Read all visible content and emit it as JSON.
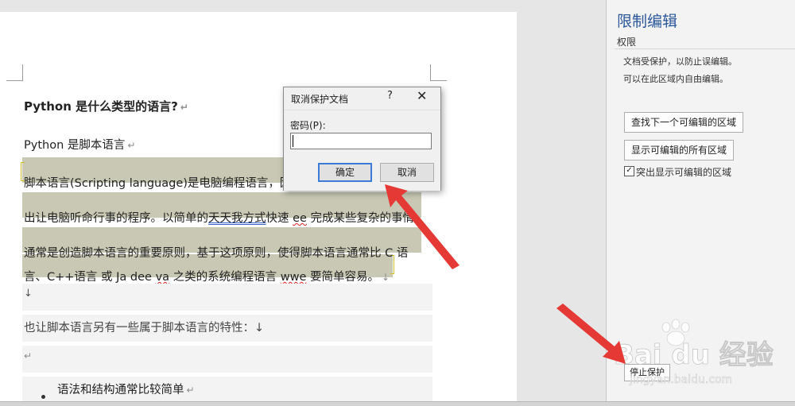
{
  "document": {
    "heading": "Python  是什么类型的语言?",
    "para_title": "Python 是脚本语言",
    "para_lines": [
      {
        "parts": [
          {
            "t": "脚本语言(Scripting language)是电脑编程语言，因"
          }
        ]
      },
      {
        "parts": [
          {
            "t": "出让电脑听命行事的程序。以简单的"
          },
          {
            "t": "天天我方式",
            "s": "dbl"
          },
          {
            "t": "快速 "
          },
          {
            "t": "ee",
            "s": "squig"
          },
          {
            "t": "  完成某些复杂的事情"
          }
        ]
      },
      {
        "parts": [
          {
            "t": "通常是创造脚本语言的重要原则，基于这项原则，使得脚本语言通常比  C 语"
          }
        ]
      },
      {
        "parts": [
          {
            "t": "言、C++语言  或  Ja   dee "
          },
          {
            "t": "va",
            "s": "squig"
          },
          {
            "t": "  之类的系统编程语言 "
          },
          {
            "t": "wwe",
            "s": "squig"
          },
          {
            "t": "  要简单容易。"
          }
        ]
      }
    ],
    "empty_line_mark": "↓",
    "feature_line": "也让脚本语言另有一些属于脚本语言的特性：↓",
    "return_mark": "↵",
    "bullet": "语法和结构通常比较简单"
  },
  "dialog": {
    "title": "取消保护文档",
    "help": "?",
    "close": "✕",
    "password_label": "密码(P):",
    "password_value": "",
    "ok_label": "确定",
    "cancel_label": "取消"
  },
  "pane": {
    "title": "限制编辑",
    "section": "权限",
    "info_lines": [
      "文档受保护，以防止误编辑。",
      "可以在此区域内自由编辑。"
    ],
    "find_next_label": "查找下一个可编辑的区域",
    "show_all_label": "显示可编辑的所有区域",
    "highlight_checked": true,
    "highlight_label": "突出显示可编辑的区域",
    "stop_protection_label": "停止保护"
  },
  "watermark": {
    "brand": "Bai du 经验",
    "url": "jingyan.baidu.com"
  },
  "colors": {
    "accent": "#2b579a",
    "arrow": "#e53935",
    "highlight": "#c8c8b4"
  }
}
